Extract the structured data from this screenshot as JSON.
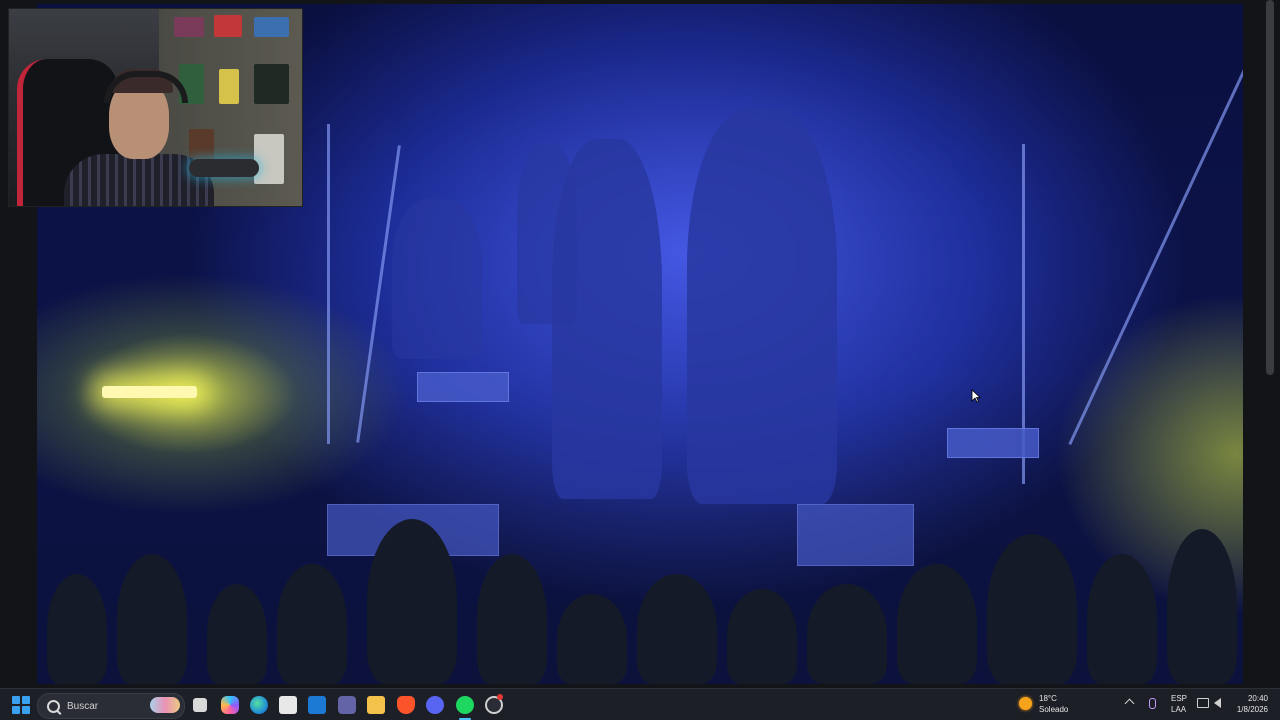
{
  "taskbar": {
    "search_label": "Buscar",
    "weather": {
      "temperature": "18°C",
      "condition": "Soleado"
    },
    "language": {
      "code": "ESP",
      "layout": "LAA"
    },
    "clock": {
      "time": "20:40",
      "date": "1/8/2026"
    },
    "pinned_apps": [
      "task-view",
      "copilot",
      "edge",
      "microsoft-store",
      "mail",
      "teams",
      "file-explorer",
      "brave",
      "discord",
      "spotify",
      "other-app"
    ]
  },
  "colors": {
    "taskbar_bg": "#1c1f26",
    "stage_blue": "#2335b0",
    "stage_yellow": "#f5f55a",
    "accent": "#4cc2ff"
  }
}
